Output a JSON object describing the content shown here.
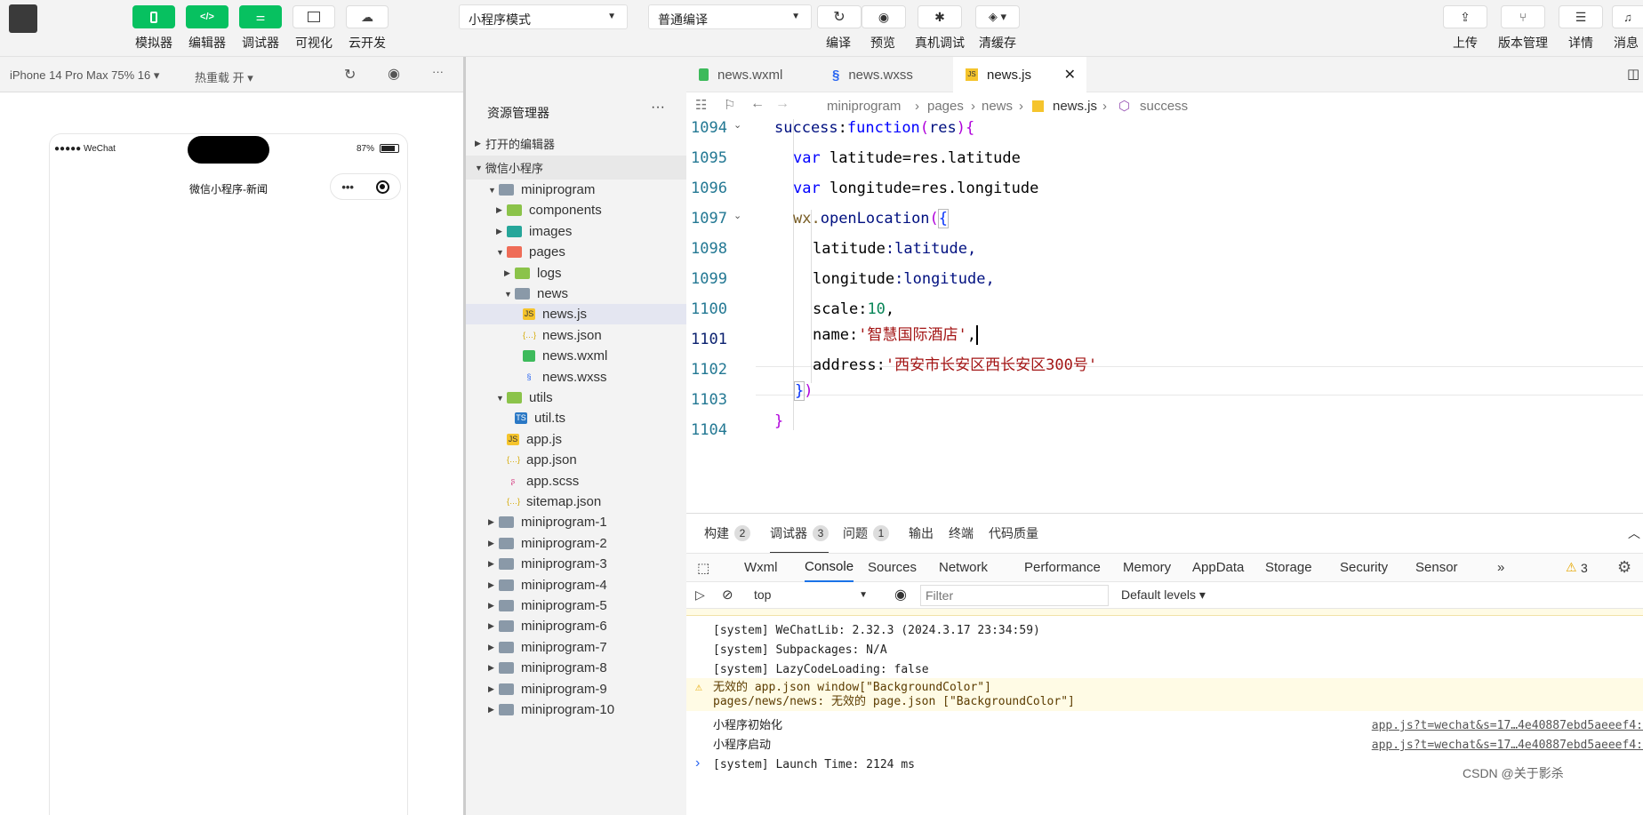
{
  "toolbar": {
    "simulator": "模拟器",
    "editor": "编辑器",
    "debugger": "调试器",
    "visual": "可视化",
    "cloud": "云开发",
    "mode_select": "小程序模式",
    "compile_select": "普通编译",
    "compile": "编译",
    "preview": "预览",
    "real_debug": "真机调试",
    "clear_cache": "清缓存",
    "upload": "上传",
    "version": "版本管理",
    "details": "详情",
    "messages": "消息"
  },
  "subbar": {
    "device": "iPhone 14 Pro Max 75% 16 ▾",
    "hot_reload": "热重载 开 ▾"
  },
  "phone": {
    "signal": "●●●●● WeChat",
    "battery": "87%",
    "title": "微信小程序-新闻"
  },
  "explorer": {
    "title": "资源管理器",
    "open_editors": "打开的编辑器",
    "project": "微信小程序",
    "tree": [
      {
        "label": "miniprogram",
        "depth": 1,
        "open": true,
        "type": "folder"
      },
      {
        "label": "components",
        "depth": 2,
        "open": false,
        "type": "folder"
      },
      {
        "label": "images",
        "depth": 2,
        "open": false,
        "type": "folder"
      },
      {
        "label": "pages",
        "depth": 2,
        "open": true,
        "type": "folder"
      },
      {
        "label": "logs",
        "depth": 3,
        "open": false,
        "type": "folder"
      },
      {
        "label": "news",
        "depth": 3,
        "open": true,
        "type": "folder"
      },
      {
        "label": "news.js",
        "depth": 4,
        "type": "js",
        "selected": true
      },
      {
        "label": "news.json",
        "depth": 4,
        "type": "json"
      },
      {
        "label": "news.wxml",
        "depth": 4,
        "type": "wxml"
      },
      {
        "label": "news.wxss",
        "depth": 4,
        "type": "wxss"
      },
      {
        "label": "utils",
        "depth": 2,
        "open": true,
        "type": "folder"
      },
      {
        "label": "util.ts",
        "depth": 3,
        "type": "ts"
      },
      {
        "label": "app.js",
        "depth": 2,
        "type": "js"
      },
      {
        "label": "app.json",
        "depth": 2,
        "type": "json"
      },
      {
        "label": "app.scss",
        "depth": 2,
        "type": "scss"
      },
      {
        "label": "sitemap.json",
        "depth": 2,
        "type": "json"
      },
      {
        "label": "miniprogram-1",
        "depth": 1,
        "open": false,
        "type": "folder"
      },
      {
        "label": "miniprogram-2",
        "depth": 1,
        "open": false,
        "type": "folder"
      },
      {
        "label": "miniprogram-3",
        "depth": 1,
        "open": false,
        "type": "folder"
      },
      {
        "label": "miniprogram-4",
        "depth": 1,
        "open": false,
        "type": "folder"
      },
      {
        "label": "miniprogram-5",
        "depth": 1,
        "open": false,
        "type": "folder"
      },
      {
        "label": "miniprogram-6",
        "depth": 1,
        "open": false,
        "type": "folder"
      },
      {
        "label": "miniprogram-7",
        "depth": 1,
        "open": false,
        "type": "folder"
      },
      {
        "label": "miniprogram-8",
        "depth": 1,
        "open": false,
        "type": "folder"
      },
      {
        "label": "miniprogram-9",
        "depth": 1,
        "open": false,
        "type": "folder"
      },
      {
        "label": "miniprogram-10",
        "depth": 1,
        "open": false,
        "type": "folder"
      }
    ]
  },
  "editor": {
    "tabs": [
      "news.wxml",
      "news.wxss",
      "news.js"
    ],
    "breadcrumb": [
      "miniprogram",
      "pages",
      "news",
      "news.js",
      "success"
    ],
    "line_numbers": [
      "1094",
      "1095",
      "1096",
      "1097",
      "1098",
      "1099",
      "1100",
      "1101",
      "1102",
      "1103",
      "1104"
    ],
    "lines": {
      "l1094": [
        "success",
        ":",
        "function",
        "(",
        "res",
        "){"
      ],
      "l1095": [
        "var",
        " latitude=res.latitude"
      ],
      "l1096": [
        "var",
        " longitude=res.longitude"
      ],
      "l1097": [
        "wx.",
        "openLocation",
        "(",
        "{"
      ],
      "l1098": [
        "latitude",
        ":latitude,"
      ],
      "l1099": [
        "longitude",
        ":longitude,"
      ],
      "l1100": [
        "scale",
        ":",
        "10",
        ","
      ],
      "l1101": [
        "name",
        ":",
        "'智慧国际酒店'",
        ","
      ],
      "l1102": [
        "address",
        ":",
        "'西安市长安区西长安区300号'"
      ],
      "l1103": [
        "}",
        ")"
      ],
      "l1104": [
        "}"
      ]
    }
  },
  "panel": {
    "tabs": [
      {
        "label": "构建",
        "badge": "2"
      },
      {
        "label": "调试器",
        "badge": "3"
      },
      {
        "label": "问题",
        "badge": "1"
      },
      {
        "label": "输出",
        "badge": ""
      },
      {
        "label": "终端",
        "badge": ""
      },
      {
        "label": "代码质量",
        "badge": ""
      }
    ],
    "devtabs": [
      "Wxml",
      "Console",
      "Sources",
      "Network",
      "Performance",
      "Memory",
      "AppData",
      "Storage",
      "Security",
      "Sensor",
      "»"
    ],
    "warn_count": "3",
    "context": "top",
    "filter_placeholder": "Filter",
    "levels": "Default levels ▾",
    "logs": [
      {
        "text": "[system] WeChatLib: 2.32.3 (2024.3.17 23:34:59)",
        "warn": false,
        "link": ""
      },
      {
        "text": "[system] Subpackages: N/A",
        "warn": false,
        "link": ""
      },
      {
        "text": "[system] LazyCodeLoading: false",
        "warn": false,
        "link": ""
      },
      {
        "text": "无效的 app.json window[\"BackgroundColor\"]\npages/news/news: 无效的 page.json [\"BackgroundColor\"]",
        "warn": true,
        "link": ""
      },
      {
        "text": "小程序初始化",
        "warn": false,
        "link": "app.js?t=wechat&s=17…4e40887ebd5aeeef4:"
      },
      {
        "text": "小程序启动",
        "warn": false,
        "link": "app.js?t=wechat&s=17…4e40887ebd5aeeef4:"
      },
      {
        "text": "[system] Launch Time: 2124 ms",
        "warn": false,
        "link": ""
      }
    ],
    "prompt": "›"
  },
  "watermark": "CSDN @关于影杀",
  "colors": {
    "accent": "#07c160",
    "selected_row": "#e4e6f1"
  }
}
